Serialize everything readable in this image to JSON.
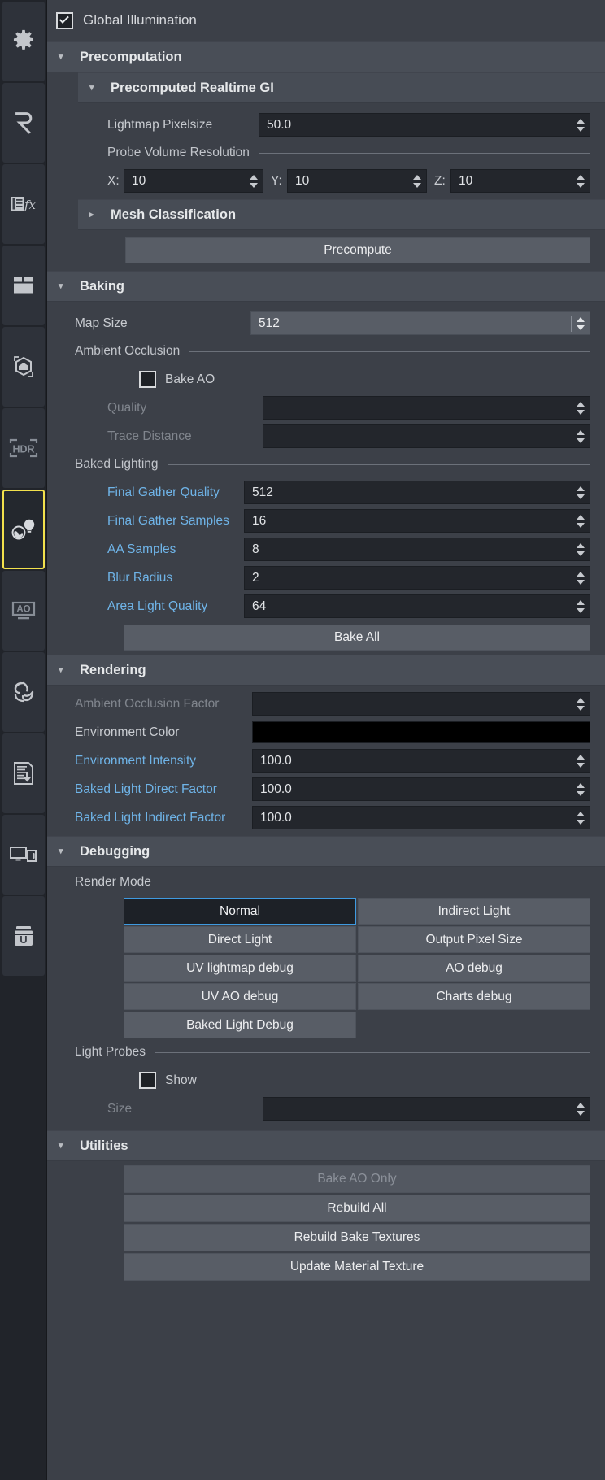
{
  "toolbar": {
    "items": [
      {
        "name": "settings-gear",
        "icon": "gear-icon"
      },
      {
        "name": "renderer-r",
        "icon": "letter-r-icon"
      },
      {
        "name": "effects-fx",
        "icon": "fx-icon"
      },
      {
        "name": "texture-atlas",
        "icon": "atlas-icon"
      },
      {
        "name": "mesh-object",
        "icon": "mesh-cube-icon"
      },
      {
        "name": "hdr",
        "icon": "hdr-icon",
        "label": "HDR"
      },
      {
        "name": "global-illumination",
        "icon": "globe-bulb-icon",
        "selected": true
      },
      {
        "name": "ambient-occlusion",
        "icon": "ao-icon",
        "label": "AO"
      },
      {
        "name": "swirl",
        "icon": "swirl-icon"
      },
      {
        "name": "document-export",
        "icon": "document-download-icon"
      },
      {
        "name": "devices",
        "icon": "monitor-phone-icon"
      },
      {
        "name": "unity-export",
        "icon": "letter-u-jar-icon"
      }
    ]
  },
  "gi": {
    "title": "Global Illumination",
    "checked": true
  },
  "precomputation": {
    "title": "Precomputation",
    "collapse_icon": "chevron-down-icon",
    "realtime_gi": {
      "title": "Precomputed Realtime GI",
      "collapse_icon": "chevron-down-icon",
      "lightmap_pixelsize": {
        "label": "Lightmap Pixelsize",
        "value": "50.0"
      },
      "probe_volume": {
        "label": "Probe Volume Resolution",
        "x": {
          "label": "X:",
          "value": "10"
        },
        "y": {
          "label": "Y:",
          "value": "10"
        },
        "z": {
          "label": "Z:",
          "value": "10"
        }
      }
    },
    "mesh_classification": {
      "title": "Mesh Classification",
      "collapse_icon": "chevron-right-icon"
    },
    "precompute_button": "Precompute"
  },
  "baking": {
    "title": "Baking",
    "collapse_icon": "chevron-down-icon",
    "map_size": {
      "label": "Map Size",
      "value": "512"
    },
    "ambient_occlusion": {
      "group_label": "Ambient Occlusion",
      "bake_ao": {
        "label": "Bake AO",
        "checked": false
      },
      "quality": {
        "label": "Quality",
        "value": "",
        "disabled": true
      },
      "trace_distance": {
        "label": "Trace Distance",
        "value": "",
        "disabled": true
      }
    },
    "baked_lighting": {
      "group_label": "Baked Lighting",
      "fields": [
        {
          "label": "Final Gather Quality",
          "value": "512"
        },
        {
          "label": "Final Gather Samples",
          "value": "16"
        },
        {
          "label": "AA Samples",
          "value": "8"
        },
        {
          "label": "Blur Radius",
          "value": "2"
        },
        {
          "label": "Area Light Quality",
          "value": "64"
        }
      ]
    },
    "bake_all_button": "Bake All"
  },
  "rendering": {
    "title": "Rendering",
    "collapse_icon": "chevron-down-icon",
    "ambient_occlusion_factor": {
      "label": "Ambient Occlusion Factor",
      "value": "",
      "disabled": true
    },
    "environment_color": {
      "label": "Environment Color",
      "color": "#000000"
    },
    "fields": [
      {
        "label": "Environment Intensity",
        "value": "100.0"
      },
      {
        "label": "Baked Light Direct Factor",
        "value": "100.0"
      },
      {
        "label": "Baked Light Indirect Factor",
        "value": "100.0"
      }
    ]
  },
  "debugging": {
    "title": "Debugging",
    "collapse_icon": "chevron-down-icon",
    "render_mode": {
      "label": "Render Mode",
      "buttons": [
        {
          "label": "Normal",
          "active": true
        },
        {
          "label": "Indirect Light",
          "active": false
        },
        {
          "label": "Direct Light",
          "active": false
        },
        {
          "label": "Output Pixel Size",
          "active": false
        },
        {
          "label": "UV lightmap debug",
          "active": false
        },
        {
          "label": "AO debug",
          "active": false
        },
        {
          "label": "UV AO debug",
          "active": false
        },
        {
          "label": "Charts debug",
          "active": false
        }
      ],
      "last_button": {
        "label": "Baked Light Debug",
        "active": false
      }
    },
    "light_probes": {
      "group_label": "Light Probes",
      "show": {
        "label": "Show",
        "checked": false
      },
      "size": {
        "label": "Size",
        "value": "",
        "disabled": true
      }
    }
  },
  "utilities": {
    "title": "Utilities",
    "collapse_icon": "chevron-down-icon",
    "buttons": [
      {
        "label": "Bake AO Only",
        "disabled": true
      },
      {
        "label": "Rebuild All",
        "disabled": false
      },
      {
        "label": "Rebuild Bake Textures",
        "disabled": false
      },
      {
        "label": "Update Material Texture",
        "disabled": false
      }
    ]
  },
  "colors": {
    "accent_selected": "#f2e14c",
    "accent_active_button": "#3f9ae0",
    "label_blue": "#6fb4e8",
    "panel_bg": "#3c4048",
    "section_bg": "#494e57"
  }
}
